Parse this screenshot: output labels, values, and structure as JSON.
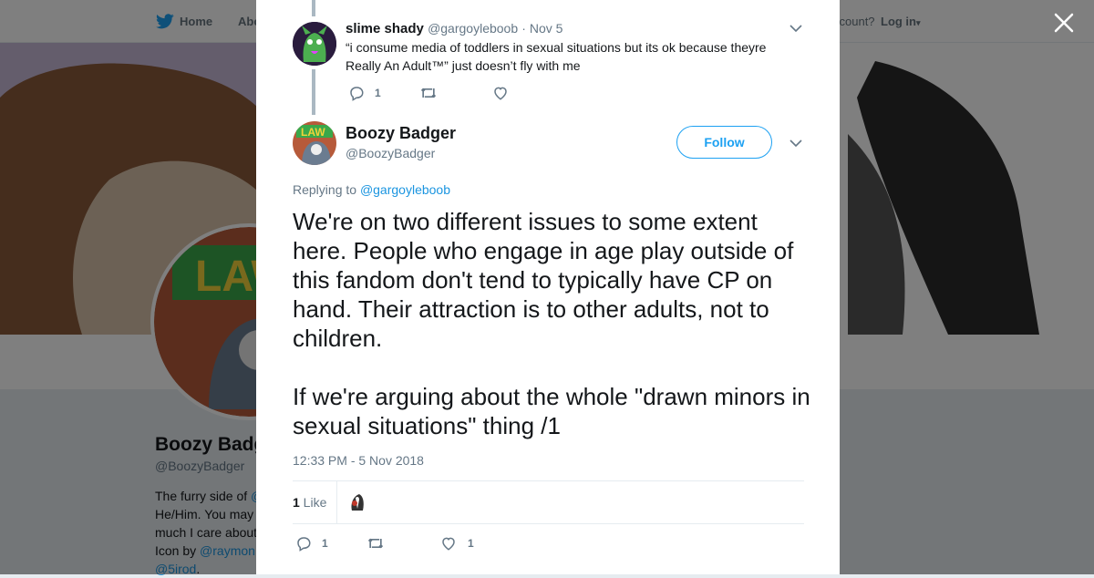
{
  "nav": {
    "home_label": "Home",
    "about_label": "Abo",
    "account_prompt": "ccount?",
    "login_label": "Log in"
  },
  "profile": {
    "name": "Boozy Badg",
    "handle": "@BoozyBadger",
    "bio_line1": "The furry side of ",
    "bio_link1": "@",
    "bio_line2": "He/Him. You may",
    "bio_line3": "much I care about",
    "bio_line4": "Icon by ",
    "bio_link2": "@raymon",
    "bio_link3": "@5irod",
    "bio_tail": "."
  },
  "parent_tweet": {
    "author_name": "slime shady",
    "author_handle": "@gargoyleboob",
    "date": "· Nov 5",
    "text": "“i consume media of toddlers in sexual situations but its ok because theyre Really An Adult™” just doesn’t fly with me",
    "reply_count": "1",
    "retweet_count": "",
    "like_count": ""
  },
  "main_tweet": {
    "author_name": "Boozy Badger",
    "author_handle": "@BoozyBadger",
    "follow_label": "Follow",
    "replying_prefix": "Replying to ",
    "replying_to": "@gargoyleboob",
    "text_p1": "We're on two different issues to some extent here. People who engage in age play outside of this fandom don't tend to typically have CP on hand. Their attraction is to other adults, not to children.",
    "text_p2": "If we're arguing about the whole \"drawn minors in sexual situations\" thing /1",
    "timestamp": "12:33 PM - 5 Nov 2018",
    "likes_num": "1",
    "likes_label": " Like",
    "reply_count": "1",
    "retweet_count": "",
    "like_count": "1"
  },
  "icons": {
    "bird": "twitter-bird-icon",
    "close": "close-icon",
    "reply": "reply-icon",
    "retweet": "retweet-icon",
    "like": "heart-icon",
    "chevron": "chevron-down-icon"
  },
  "colors": {
    "accent": "#1da1f2",
    "link": "#1b95e0",
    "text": "#14171a",
    "muted": "#657786"
  }
}
